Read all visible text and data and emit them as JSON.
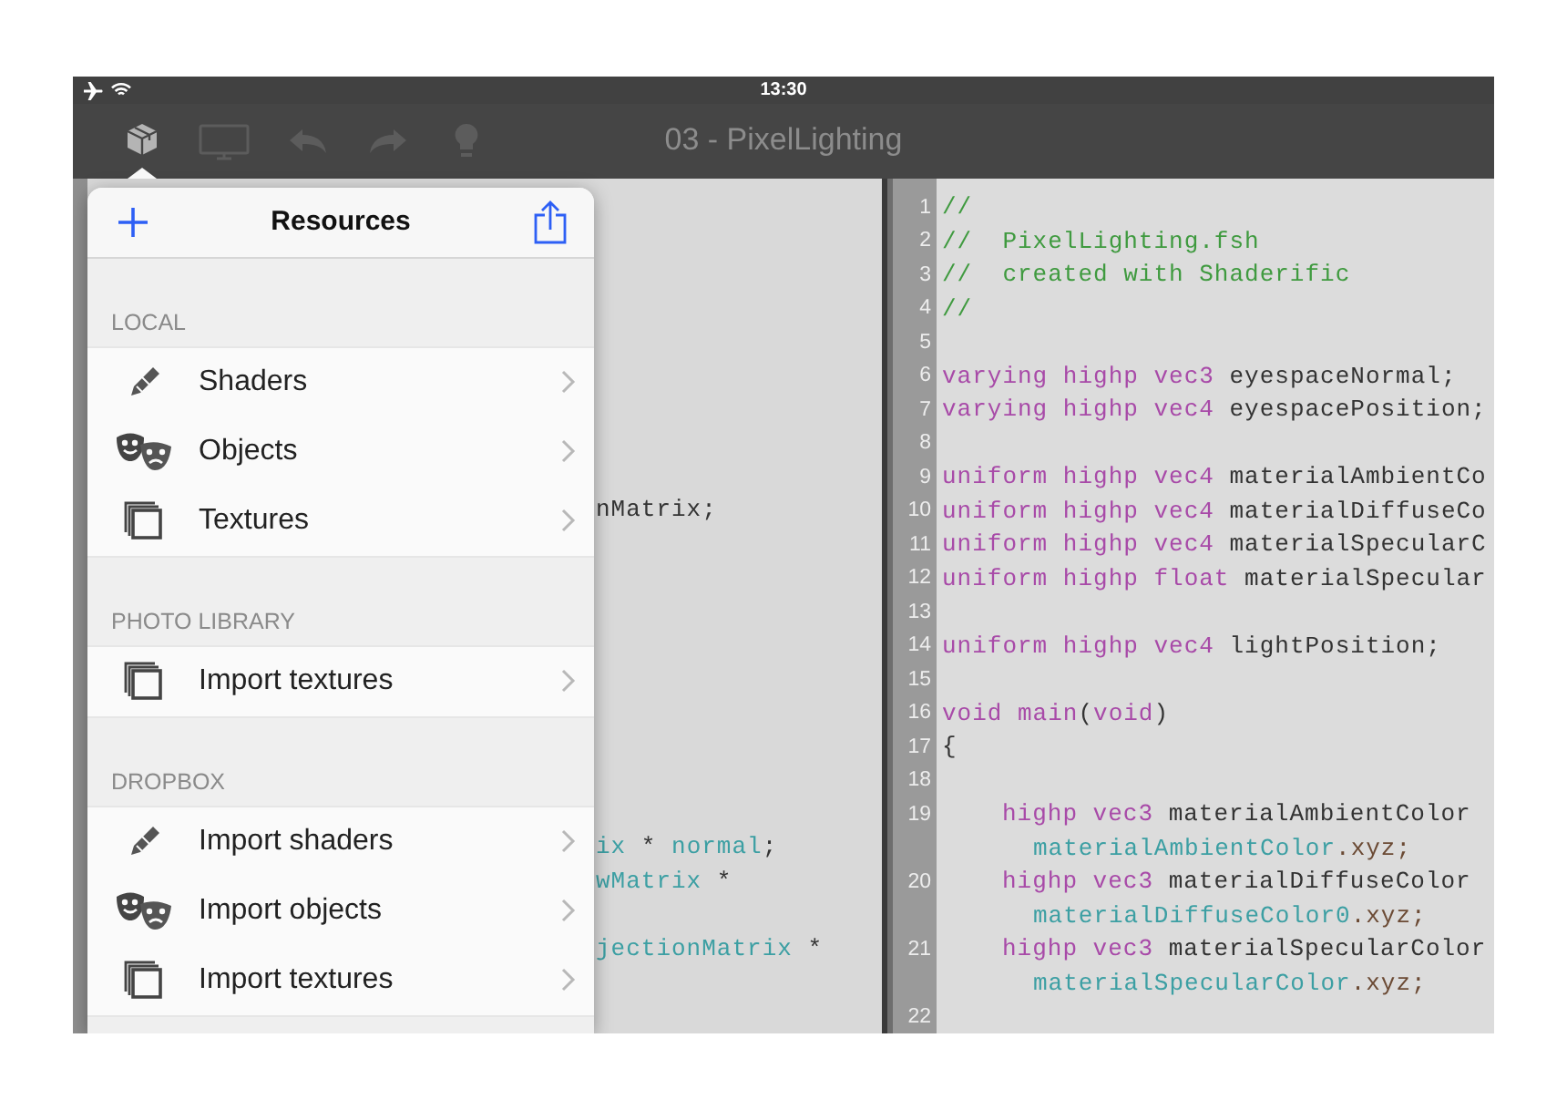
{
  "status_bar": {
    "time": "13:30"
  },
  "toolbar": {
    "title": "03 - PixelLighting",
    "tools": [
      {
        "kind": "cube",
        "disabled": false
      },
      {
        "kind": "monitor",
        "disabled": true
      },
      {
        "kind": "undo",
        "disabled": true
      },
      {
        "kind": "redo",
        "disabled": true
      },
      {
        "kind": "bulb",
        "disabled": true
      }
    ]
  },
  "popover": {
    "title": "Resources",
    "sections": [
      {
        "header": "LOCAL",
        "items": [
          {
            "label": "Shaders",
            "kind": "pencil"
          },
          {
            "label": "Objects",
            "kind": "masks"
          },
          {
            "label": "Textures",
            "kind": "pages"
          }
        ]
      },
      {
        "header": "PHOTO LIBRARY",
        "items": [
          {
            "label": "Import textures",
            "kind": "pages"
          }
        ]
      },
      {
        "header": "DROPBOX",
        "items": [
          {
            "label": "Import shaders",
            "kind": "pencil"
          },
          {
            "label": "Import objects",
            "kind": "masks"
          },
          {
            "label": "Import textures",
            "kind": "pages"
          }
        ]
      }
    ]
  },
  "left_editor": {
    "fragments": [
      {
        "tokens": [
          {
            "kind": "plain",
            "text": "nMatrix;"
          }
        ]
      },
      {
        "tokens": [
          {
            "kind": "member",
            "text": "ix"
          },
          {
            "kind": "plain",
            "text": " * "
          },
          {
            "kind": "member",
            "text": "normal"
          },
          {
            "kind": "plain",
            "text": ";"
          }
        ]
      },
      {
        "tokens": [
          {
            "kind": "member",
            "text": "wMatrix"
          },
          {
            "kind": "plain",
            "text": " *"
          }
        ]
      },
      {
        "tokens": [
          {
            "kind": "member",
            "text": "jectionMatrix"
          },
          {
            "kind": "plain",
            "text": " *"
          }
        ]
      }
    ]
  },
  "right_editor": {
    "lines": [
      {
        "number": "1",
        "tokens": [
          {
            "kind": "comment",
            "text": "//"
          }
        ]
      },
      {
        "number": "2",
        "tokens": [
          {
            "kind": "comment",
            "text": "//  PixelLighting.fsh"
          }
        ]
      },
      {
        "number": "3",
        "tokens": [
          {
            "kind": "comment",
            "text": "//  created with Shaderific"
          }
        ]
      },
      {
        "number": "4",
        "tokens": [
          {
            "kind": "comment",
            "text": "//"
          }
        ]
      },
      {
        "number": "5"
      },
      {
        "number": "6",
        "tokens": [
          {
            "kind": "keyword",
            "text": "varying highp vec3"
          },
          {
            "kind": "plain",
            "text": " eyespaceNormal;"
          }
        ]
      },
      {
        "number": "7",
        "tokens": [
          {
            "kind": "keyword",
            "text": "varying highp vec4"
          },
          {
            "kind": "plain",
            "text": " eyespacePosition;"
          }
        ]
      },
      {
        "number": "8"
      },
      {
        "number": "9",
        "tokens": [
          {
            "kind": "keyword",
            "text": "uniform highp vec4"
          },
          {
            "kind": "plain",
            "text": " materialAmbientCo"
          }
        ]
      },
      {
        "number": "10",
        "tokens": [
          {
            "kind": "keyword",
            "text": "uniform highp vec4"
          },
          {
            "kind": "plain",
            "text": " materialDiffuseCo"
          }
        ]
      },
      {
        "number": "11",
        "tokens": [
          {
            "kind": "keyword",
            "text": "uniform highp vec4"
          },
          {
            "kind": "plain",
            "text": " materialSpecularC"
          }
        ]
      },
      {
        "number": "12",
        "tokens": [
          {
            "kind": "keyword",
            "text": "uniform highp float"
          },
          {
            "kind": "plain",
            "text": " materialSpecular"
          }
        ]
      },
      {
        "number": "13"
      },
      {
        "number": "14",
        "tokens": [
          {
            "kind": "keyword",
            "text": "uniform highp vec4"
          },
          {
            "kind": "plain",
            "text": " lightPosition;"
          }
        ]
      },
      {
        "number": "15"
      },
      {
        "number": "16",
        "tokens": [
          {
            "kind": "keyword",
            "text": "void main"
          },
          {
            "kind": "plain",
            "text": "("
          },
          {
            "kind": "keyword",
            "text": "void"
          },
          {
            "kind": "plain",
            "text": ")"
          }
        ]
      },
      {
        "number": "17",
        "tokens": [
          {
            "kind": "plain",
            "text": "{"
          }
        ]
      },
      {
        "number": "18"
      },
      {
        "number": "19",
        "indented": true,
        "tokens": [
          {
            "kind": "keyword",
            "text": "highp vec3"
          },
          {
            "kind": "plain",
            "text": " materialAmbientColor"
          }
        ],
        "wrap": [
          {
            "kind": "member",
            "text": "materialAmbientColor"
          },
          {
            "kind": "swizzle",
            "text": ".xyz;"
          }
        ]
      },
      {
        "number": "20",
        "indented": true,
        "tokens": [
          {
            "kind": "keyword",
            "text": "highp vec3"
          },
          {
            "kind": "plain",
            "text": " materialDiffuseColor"
          }
        ],
        "wrap": [
          {
            "kind": "member",
            "text": "materialDiffuseColor0"
          },
          {
            "kind": "swizzle",
            "text": ".xyz;"
          }
        ]
      },
      {
        "number": "21",
        "indented": true,
        "tokens": [
          {
            "kind": "keyword",
            "text": "highp vec3"
          },
          {
            "kind": "plain",
            "text": " materialSpecularColor"
          }
        ],
        "wrap": [
          {
            "kind": "member",
            "text": "materialSpecularColor"
          },
          {
            "kind": "swizzle",
            "text": ".xyz;"
          }
        ]
      },
      {
        "number": "22"
      }
    ]
  }
}
